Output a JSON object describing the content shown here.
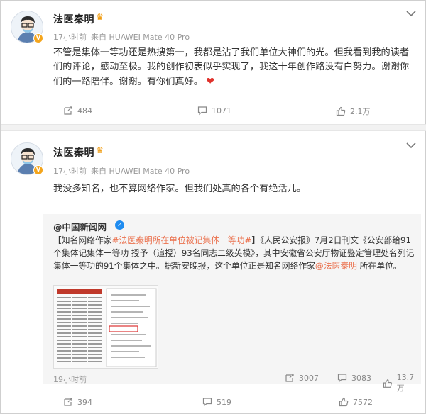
{
  "posts": [
    {
      "username": "法医秦明",
      "time": "17小时前",
      "source": "来自 HUAWEI Mate 40 Pro",
      "text": "不管是集体一等功还是热搜第一，我都是沾了我们单位大神们的光。但我看到我的读者们的评论，感动至极。我的创作初衷似乎实现了，我这十年创作路没有白努力。谢谢你们的一路陪伴。谢谢。有你们真好。",
      "heart": "❤",
      "actions": {
        "repost": "484",
        "comment": "1071",
        "like": "2.1万"
      }
    },
    {
      "username": "法医秦明",
      "time": "17小时前",
      "source": "来自 HUAWEI Mate 40 Pro",
      "text": "我没多知名，也不算网络作家。但我们处真的各个有绝活儿。",
      "repost": {
        "author": "@中国新闻网",
        "text_prefix": "【知名网络作家",
        "hashtag": "#法医秦明所在单位被记集体一等功#",
        "text_main": "】《人民公安报》7月2日刊文《公安部给91个集体记集体一等功 授予（追授）93名同志二级英模》，其中安徽省公安厅物证鉴定管理处名列记集体一等功的91个集体之中。据新安晚报，这个单位正是知名网络作家",
        "mention": "@法医秦明",
        "text_suffix": " 所在单位。",
        "time": "19小时前",
        "actions": {
          "repost": "3007",
          "comment": "3083",
          "like": "13.7万"
        }
      },
      "actions": {
        "repost": "394",
        "comment": "519",
        "like": "7572"
      }
    }
  ],
  "colors": {
    "link": "#eb7350",
    "verified_personal": "#f4a51c",
    "verified_org": "#1f8cf0",
    "heart": "#e0322c"
  }
}
